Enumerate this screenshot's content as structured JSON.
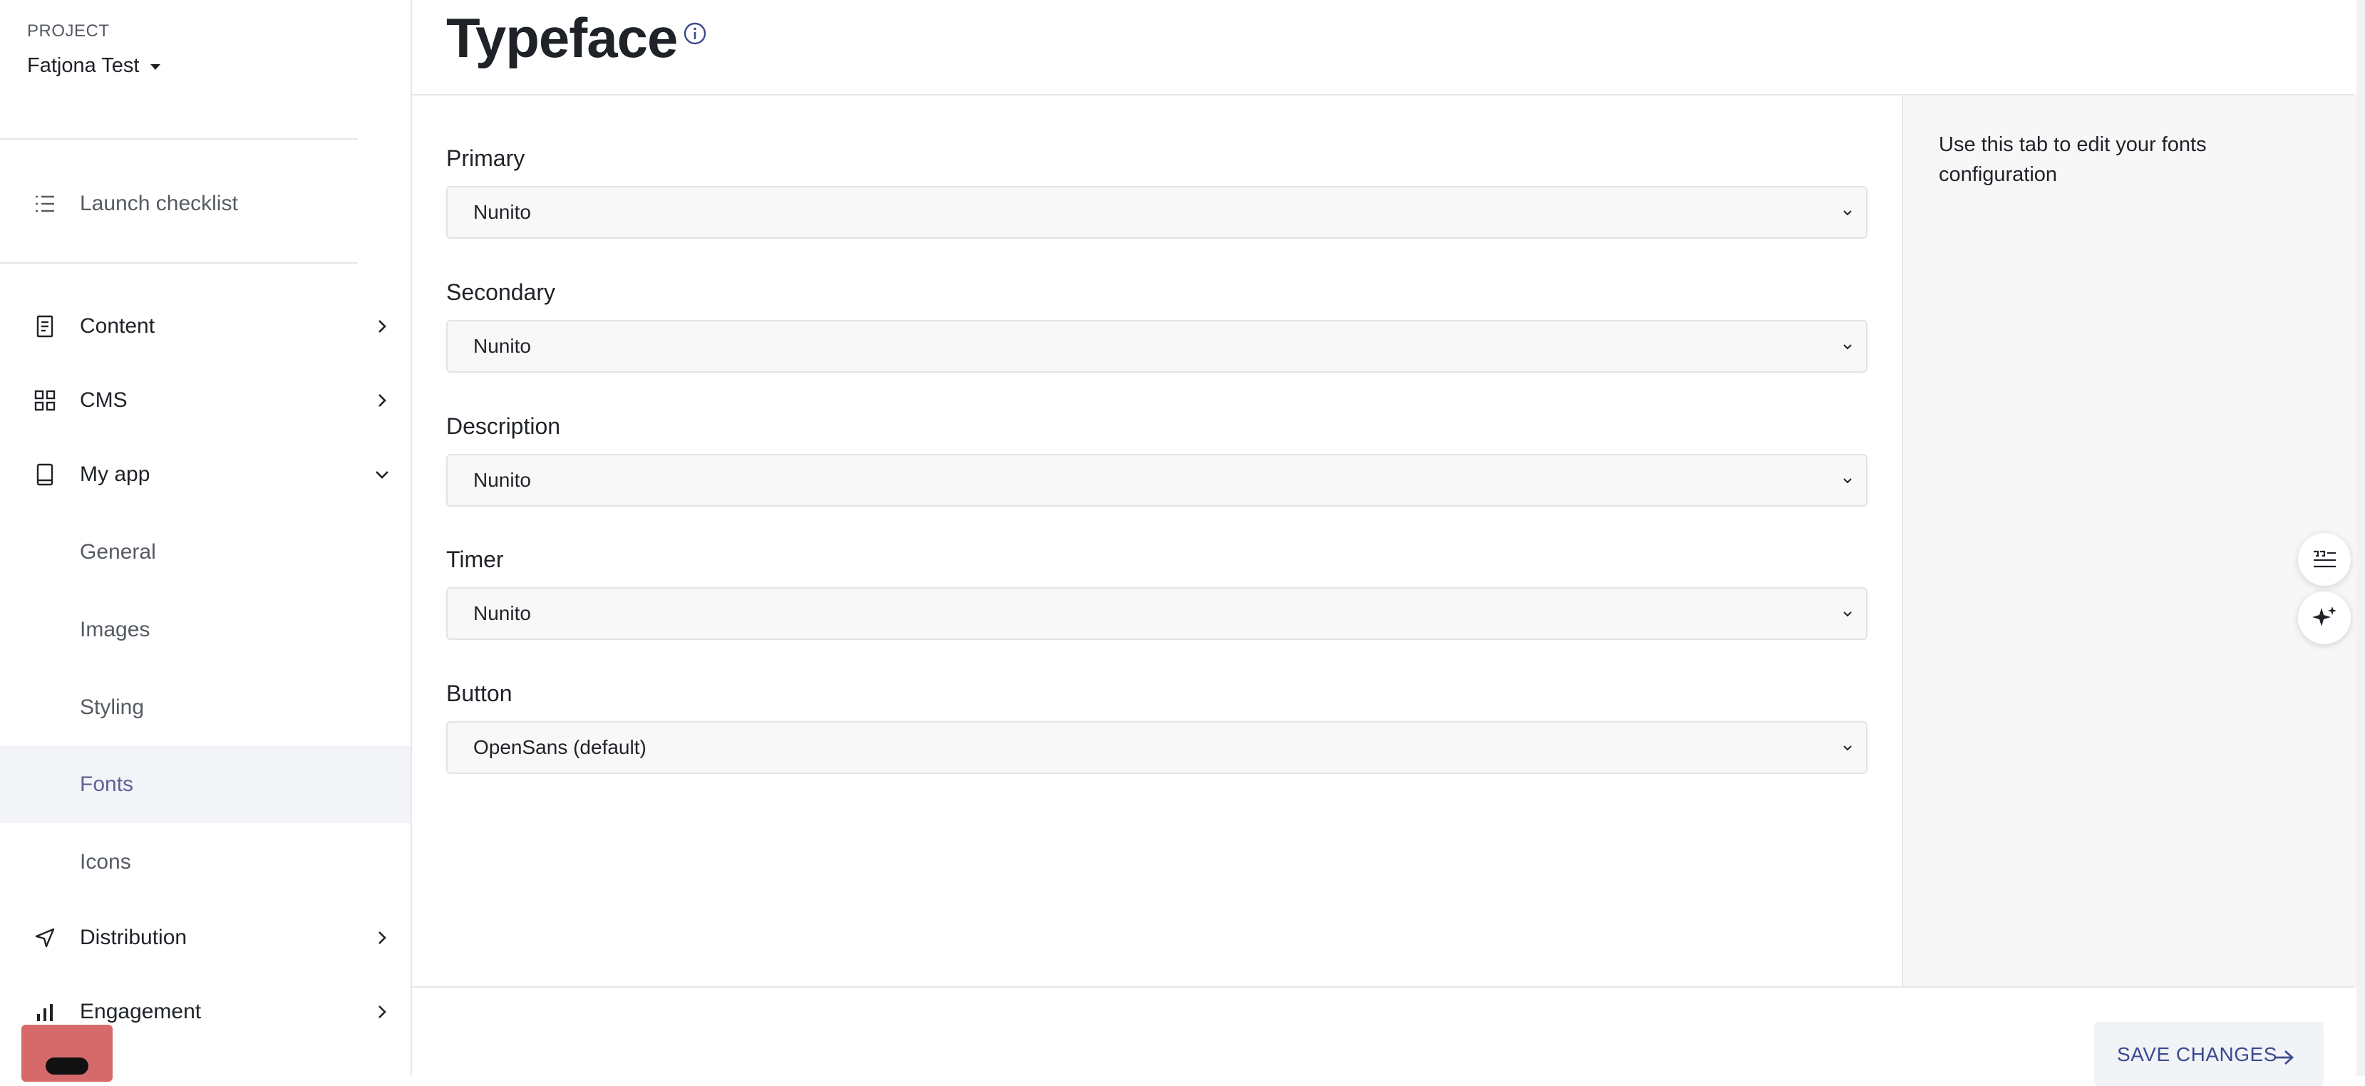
{
  "sidebar": {
    "project_label": "PROJECT",
    "project_name": "Fatjona Test",
    "launch_checklist": "Launch checklist",
    "items": [
      {
        "label": "Content"
      },
      {
        "label": "CMS"
      },
      {
        "label": "My app"
      }
    ],
    "my_app_subitems": [
      {
        "label": "General"
      },
      {
        "label": "Images"
      },
      {
        "label": "Styling"
      },
      {
        "label": "Fonts"
      },
      {
        "label": "Icons"
      }
    ],
    "distribution": "Distribution",
    "engagement": "Engagement"
  },
  "header": {
    "title": "Typeface"
  },
  "form": {
    "fields": [
      {
        "label": "Primary",
        "value": "Nunito"
      },
      {
        "label": "Secondary",
        "value": "Nunito"
      },
      {
        "label": "Description",
        "value": "Nunito"
      },
      {
        "label": "Timer",
        "value": "Nunito"
      },
      {
        "label": "Button",
        "value": "OpenSans (default)"
      }
    ]
  },
  "help_panel": {
    "text": "Use this tab to edit your fonts configuration"
  },
  "footer": {
    "save_label": "SAVE CHANGES"
  },
  "colors": {
    "accent": "#3b4a8f",
    "active_nav_bg": "#f2f4f8",
    "active_nav_text": "#5f6295",
    "help_widget": "#d66a6b"
  },
  "icons": {
    "launch": "list-icon",
    "content": "document-icon",
    "cms": "grid-icon",
    "my_app": "tablet-icon",
    "distribution": "send-icon",
    "engagement": "bar-chart-icon"
  }
}
